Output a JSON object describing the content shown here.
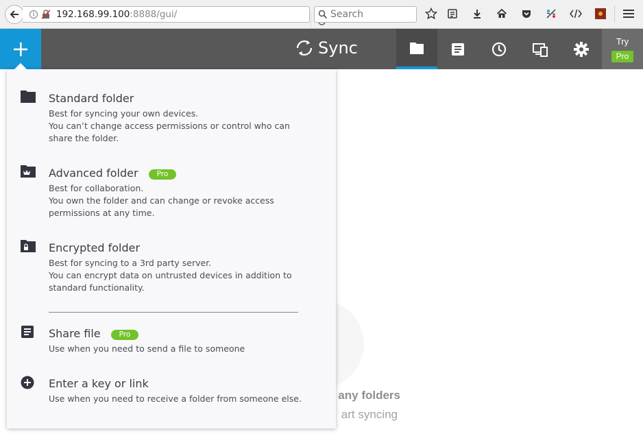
{
  "browser": {
    "url_host": "192.168.99.100",
    "url_port_path": ":8888/gui/",
    "search_placeholder": "Search"
  },
  "header": {
    "logo_text": "Sync",
    "try_label": "Try",
    "pro_label": "Pro",
    "nav_tabs": [
      {
        "name": "folders",
        "icon": "folder-icon",
        "active": true
      },
      {
        "name": "history",
        "icon": "document-icon",
        "active": false
      },
      {
        "name": "transfers",
        "icon": "clock-icon",
        "active": false
      },
      {
        "name": "devices",
        "icon": "devices-icon",
        "active": false
      },
      {
        "name": "settings",
        "icon": "gear-icon",
        "active": false
      }
    ],
    "accent_color": "#1497d6",
    "pro_color": "#74c32b"
  },
  "menu": {
    "items": [
      {
        "title": "Standard folder",
        "icon": "folder-icon",
        "desc": [
          "Best for syncing your own devices.",
          "You can’t change access permissions or control who can",
          "share the folder."
        ]
      },
      {
        "title": "Advanced folder",
        "icon": "crown-folder-icon",
        "badge": "Pro",
        "desc": [
          "Best for collaboration.",
          "You own the folder and can change or revoke access",
          "permissions at any time."
        ]
      },
      {
        "title": "Encrypted folder",
        "icon": "lock-folder-icon",
        "desc": [
          "Best for syncing to a 3rd party server.",
          "You can encrypt data on untrusted devices in addition to",
          "standard functionality."
        ]
      },
      {
        "title": "Share file",
        "icon": "file-icon",
        "badge": "Pro",
        "desc": [
          "Use when you need to send a file to someone"
        ]
      },
      {
        "title": "Enter a key or link",
        "icon": "plus-circle-icon",
        "desc": [
          "Use when you need to receive a folder from someone else."
        ]
      }
    ]
  },
  "empty_state": {
    "title_partial": "any folders",
    "subtitle_partial": "art syncing"
  }
}
